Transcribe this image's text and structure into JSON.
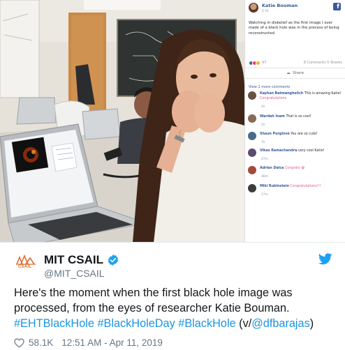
{
  "facebook_post": {
    "author": "Katie Bouman",
    "time": "1 hr",
    "caption": "Watching in disbelief as the first image I ever made of a black hole was in the process of being reconstructed.",
    "reaction_count": "97",
    "comment_share_counts": "8 Comments 5 Shares",
    "share_label": "Share",
    "view_more": "View 2 more comments",
    "comments": [
      {
        "name": "Kayhan Batmanghelich",
        "text": "This is amazing Katie!",
        "emph": "Congratulations",
        "time": "1h",
        "avatar_color": "#6b5344"
      },
      {
        "name": "Wardah Inam",
        "text": "That is so cool!",
        "emph": "",
        "time": "1h",
        "avatar_color": "#8a6a55"
      },
      {
        "name": "Shaun Purglove",
        "text": "You are so cute!",
        "emph": "",
        "time": "1h",
        "avatar_color": "#4a6a8a"
      },
      {
        "name": "Vikas Ramachandra",
        "text": "very cool Katie!",
        "emph": "",
        "time": "47m",
        "avatar_color": "#5a4d6e"
      },
      {
        "name": "Adrian Dalca",
        "text": "",
        "emph": "Congrats 😀",
        "time": "38m",
        "avatar_color": "#a34a3a"
      },
      {
        "name": "Miki Rubinstein",
        "text": "",
        "emph": "Congratulations!!!",
        "time": "17m",
        "avatar_color": "#3d3d3d"
      }
    ]
  },
  "tweet": {
    "account_name": "MIT CSAIL",
    "handle": "@MIT_CSAIL",
    "logo_text": "CSAIL",
    "text_plain": "Here's the moment when the first black hole image was processed, from the eyes of researcher Katie Bouman.",
    "hashtags": "#EHTBlackHole #BlackHoleDay #BlackHole",
    "via_open": " (v/",
    "via_user": "@dfbarajas",
    "via_close": ")",
    "likes": "58.1K",
    "timestamp": "12:51 AM - Apr 11, 2019"
  },
  "colors": {
    "link": "#1b95e0",
    "facebook_blue": "#385898",
    "twitter_blue": "#1da1f2",
    "csail_orange": "#e36c2b"
  }
}
